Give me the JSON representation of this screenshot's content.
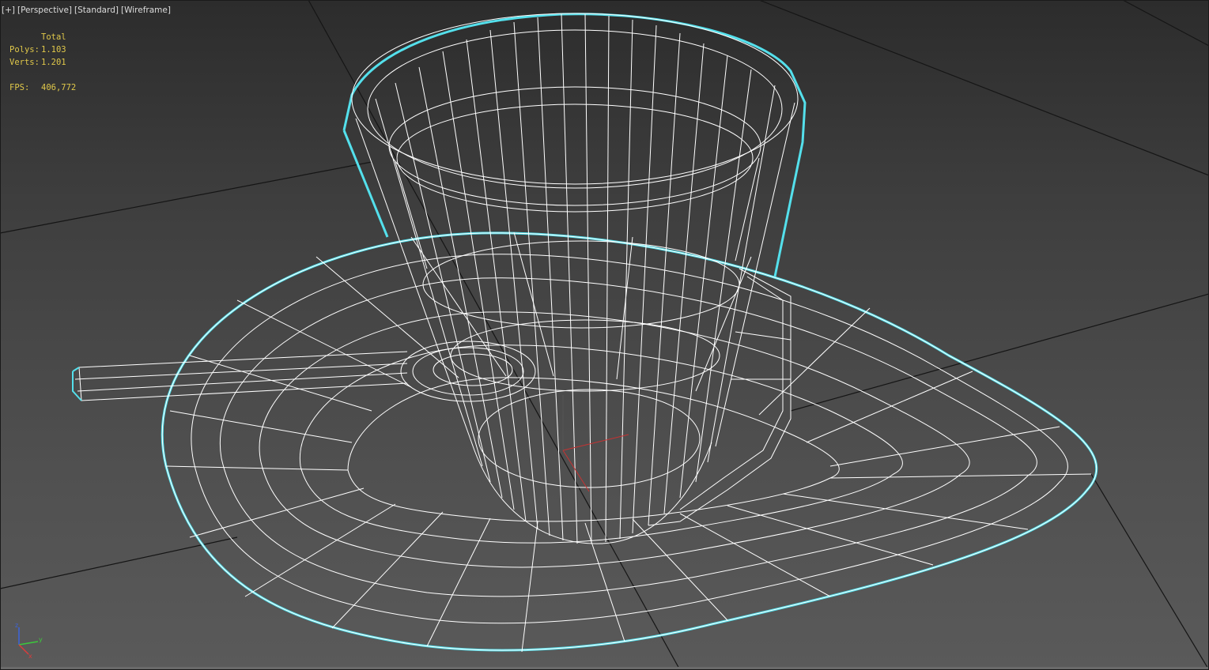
{
  "viewport": {
    "labels": [
      "[+]",
      "[Perspective]",
      "[Standard]",
      "[Wireframe]"
    ]
  },
  "stats": {
    "header": "Total",
    "polys_label": "Polys:",
    "polys_value": "1.103",
    "verts_label": "Verts:",
    "verts_value": "1.201",
    "fps_label": "FPS:",
    "fps_value": "406,772"
  },
  "axis_gizmo": {
    "x": "x",
    "y": "y",
    "z": "z"
  },
  "colors": {
    "wire": "#ffffff",
    "selection": "#54e0ec",
    "grid": "#111111",
    "stats_text": "#e0c84a",
    "label_text": "#dcdcdc"
  },
  "icons": [
    "axis-tripod-icon"
  ]
}
